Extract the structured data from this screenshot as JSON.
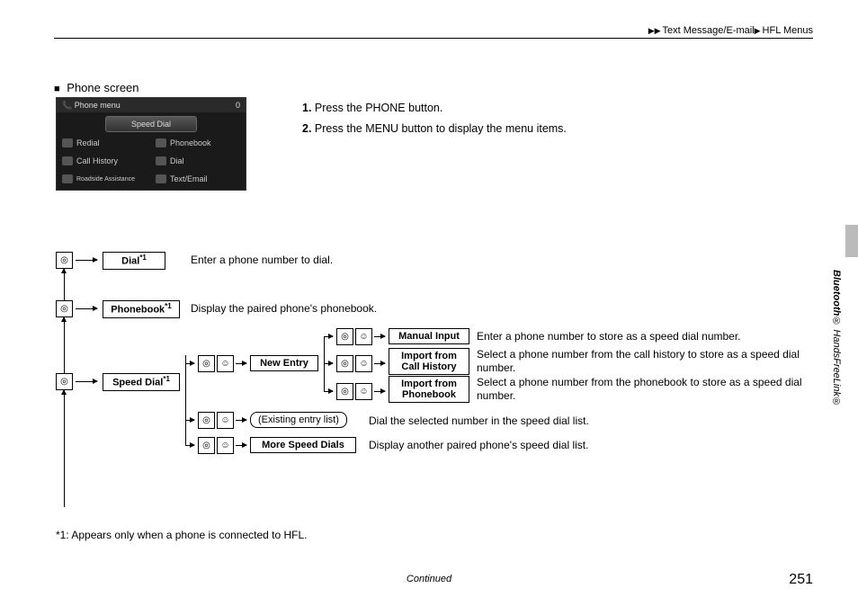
{
  "header": {
    "crumb1": "Text Message/E-mail",
    "crumb2": "HFL Menus"
  },
  "section_title": "Phone screen",
  "phone_screenshot": {
    "title": "Phone menu",
    "signal": "0",
    "speed_dial": "Speed Dial",
    "row1_left": "Redial",
    "row1_right": "Phonebook",
    "row2_left": "Call History",
    "row2_right": "Dial",
    "row3_left": "Roadside Assistance",
    "row3_right": "Text/Email"
  },
  "steps": {
    "s1": "Press the PHONE button.",
    "s2": "Press the MENU button to display the menu items."
  },
  "diagram": {
    "dial": "Dial",
    "dial_sup": "*1",
    "dial_desc": "Enter a phone number to dial.",
    "phonebook": "Phonebook",
    "phonebook_sup": "*1",
    "phonebook_desc": "Display the paired phone's phonebook.",
    "speed_dial": "Speed Dial",
    "speed_dial_sup": "*1",
    "new_entry": "New Entry",
    "manual_input": "Manual Input",
    "manual_input_desc": "Enter a phone number to store as a speed dial number.",
    "import_call": "Import from Call History",
    "import_call_desc": "Select a phone number from the call history to store as a speed dial number.",
    "import_pb": "Import from Phonebook",
    "import_pb_desc": "Select a phone number from the phonebook to store as a speed dial number.",
    "existing": "(Existing entry list)",
    "existing_desc": "Dial the selected number in the speed dial list.",
    "more_sd": "More Speed Dials",
    "more_sd_desc": "Display another paired phone's speed dial list."
  },
  "footnote": "*1: Appears only when a phone is connected to HFL.",
  "continued": "Continued",
  "page_number": "251",
  "side_label": "Bluetooth® HandsFreeLink®"
}
